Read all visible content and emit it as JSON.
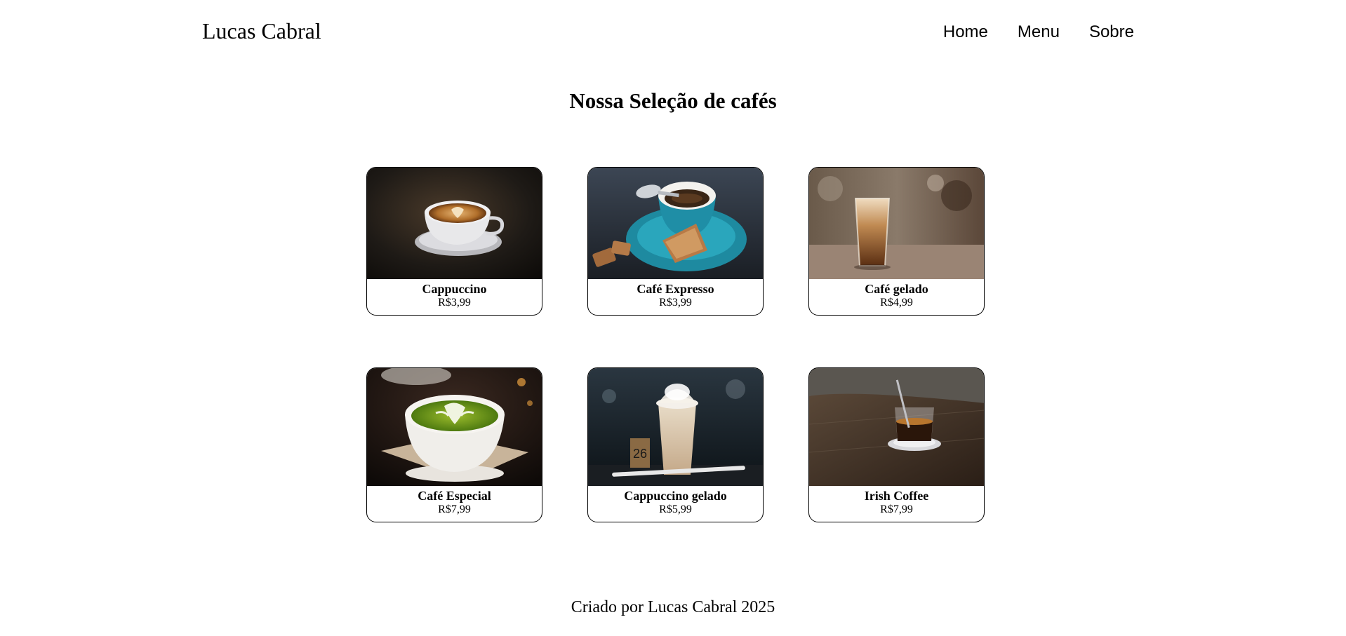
{
  "header": {
    "brand": "Lucas Cabral",
    "nav": [
      {
        "label": "Home"
      },
      {
        "label": "Menu"
      },
      {
        "label": "Sobre"
      }
    ]
  },
  "main": {
    "title": "Nossa Seleção de cafés",
    "products": [
      {
        "name": "Cappuccino",
        "price": "R$3,99",
        "image": "cappuccino-photo"
      },
      {
        "name": "Café Expresso",
        "price": "R$3,99",
        "image": "espresso-photo"
      },
      {
        "name": "Café gelado",
        "price": "R$4,99",
        "image": "iced-coffee-photo"
      },
      {
        "name": "Café Especial",
        "price": "R$7,99",
        "image": "matcha-latte-photo"
      },
      {
        "name": "Cappuccino gelado",
        "price": "R$5,99",
        "image": "iced-cappuccino-photo"
      },
      {
        "name": "Irish Coffee",
        "price": "R$7,99",
        "image": "irish-coffee-photo"
      }
    ]
  },
  "footer": {
    "text": "Criado por Lucas Cabral 2025"
  }
}
